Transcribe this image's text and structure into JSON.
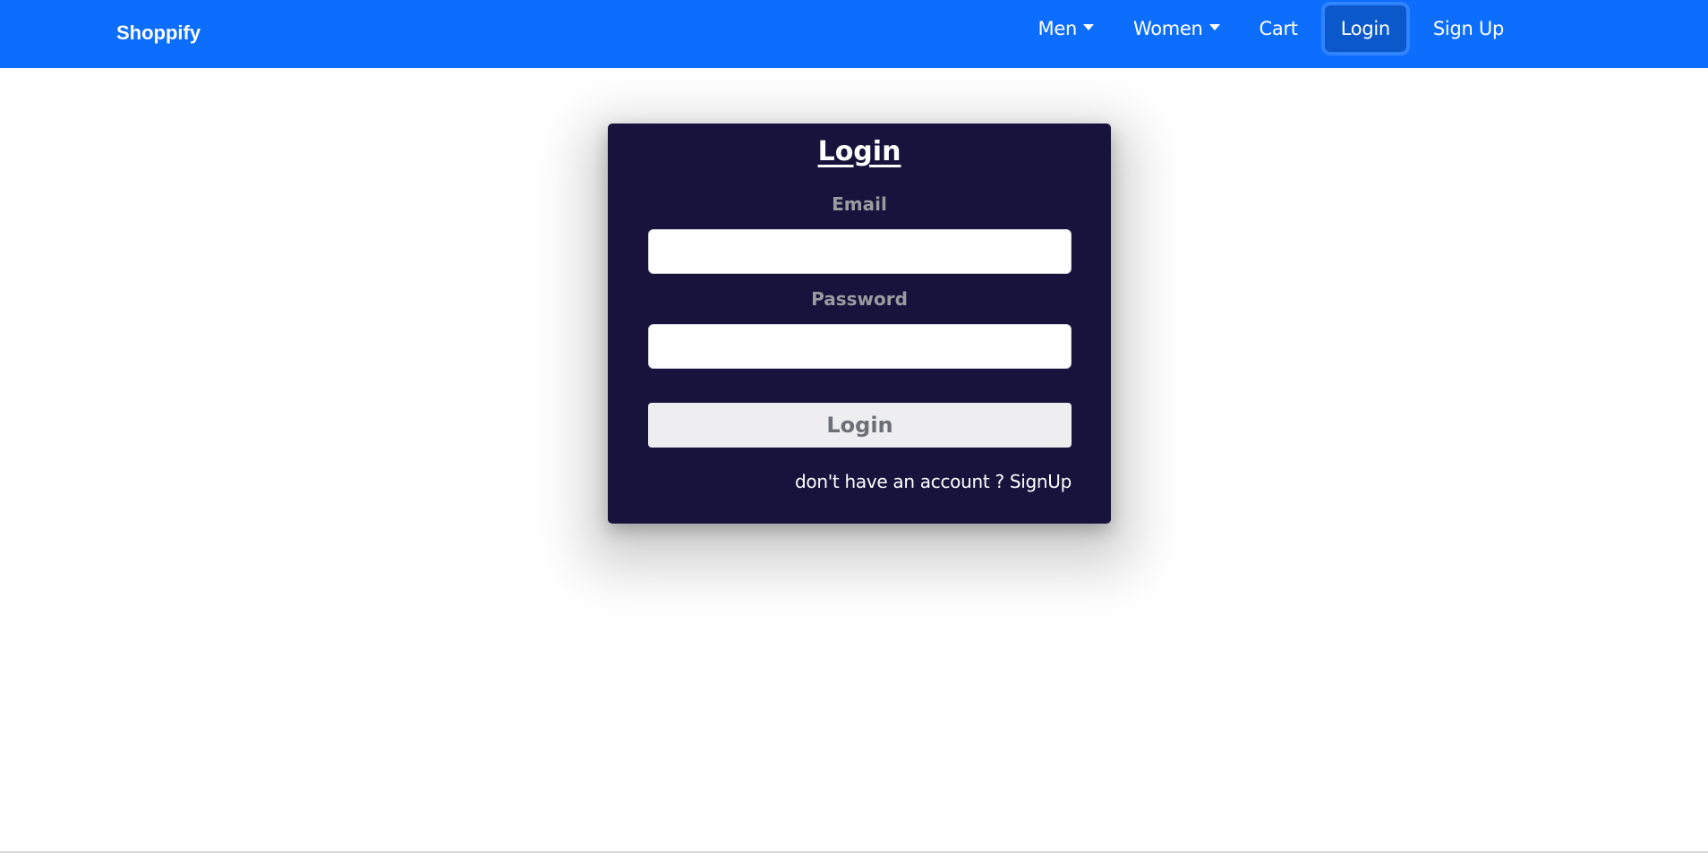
{
  "navbar": {
    "brand": "Shoppify",
    "links": [
      {
        "label": "Men"
      },
      {
        "label": "Women"
      },
      {
        "label": "Cart"
      },
      {
        "label": "Login"
      },
      {
        "label": "Sign Up"
      }
    ],
    "active_link": "Login",
    "color": "#0d6efd"
  },
  "login_card": {
    "title": "Login",
    "email_label": "Email",
    "email_value": "",
    "password_label": "Password",
    "password_value": "",
    "submit_label": "Login",
    "signup_prompt": "don't have an account ?",
    "signup_link": "SignUp",
    "background": "#17133c"
  }
}
